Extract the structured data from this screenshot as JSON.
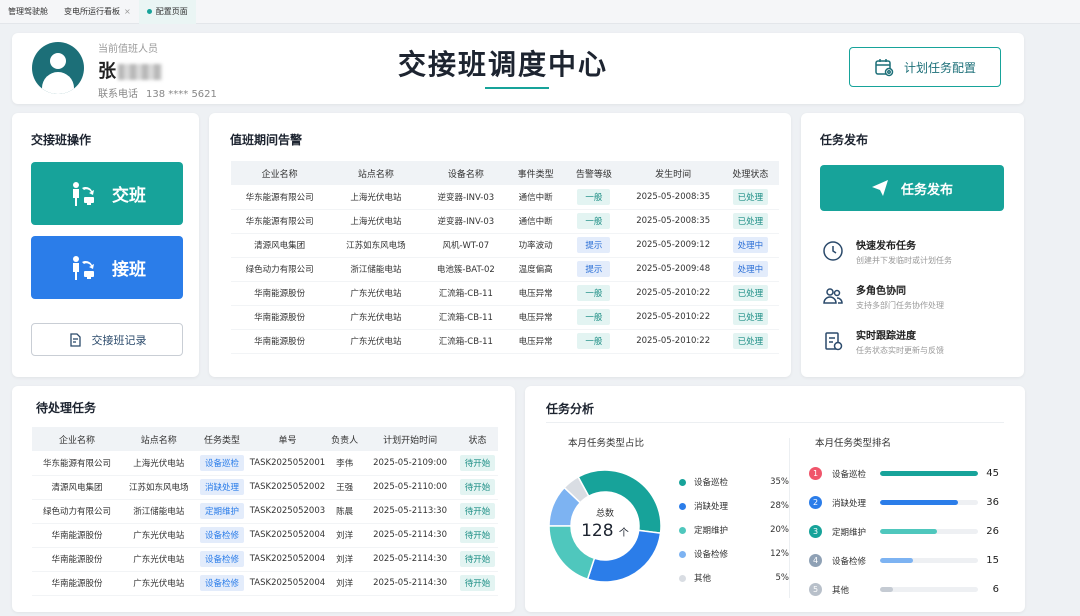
{
  "tabs": [
    {
      "label": "管理驾驶舱",
      "active": false,
      "closable": false
    },
    {
      "label": "变电所运行看板",
      "active": false,
      "closable": true
    },
    {
      "label": "配置页面",
      "active": true,
      "closable": false
    }
  ],
  "header": {
    "duty_label": "当前值班人员",
    "duty_name": "张",
    "phone_label": "联系电话",
    "phone_value": "138 **** 5621",
    "title": "交接班调度中心",
    "config_button": "计划任务配置"
  },
  "handover": {
    "title": "交接班操作",
    "handover_button": "交班",
    "takeover_button": "接班",
    "record_button": "交接班记录"
  },
  "alarms": {
    "title": "值班期间告警",
    "columns": [
      "企业名称",
      "站点名称",
      "设备名称",
      "事件类型",
      "告警等级",
      "发生时间",
      "处理状态"
    ],
    "rows": [
      {
        "company": "华东能源有限公司",
        "station": "上海光伏电站",
        "device": "逆变器-INV-03",
        "event": "通信中断",
        "level": "一般",
        "time": "2025-05-2008:35",
        "status": "已处理"
      },
      {
        "company": "华东能源有限公司",
        "station": "上海光伏电站",
        "device": "逆变器-INV-03",
        "event": "通信中断",
        "level": "一般",
        "time": "2025-05-2008:35",
        "status": "已处理"
      },
      {
        "company": "清源风电集团",
        "station": "江苏如东风电场",
        "device": "风机-WT-07",
        "event": "功率波动",
        "level": "提示",
        "time": "2025-05-2009:12",
        "status": "处理中"
      },
      {
        "company": "绿色动力有限公司",
        "station": "浙江储能电站",
        "device": "电池簇-BAT-02",
        "event": "温度偏高",
        "level": "提示",
        "time": "2025-05-2009:48",
        "status": "处理中"
      },
      {
        "company": "华南能源股份",
        "station": "广东光伏电站",
        "device": "汇流箱-CB-11",
        "event": "电压异常",
        "level": "一般",
        "time": "2025-05-2010:22",
        "status": "已处理"
      },
      {
        "company": "华南能源股份",
        "station": "广东光伏电站",
        "device": "汇流箱-CB-11",
        "event": "电压异常",
        "level": "一般",
        "time": "2025-05-2010:22",
        "status": "已处理"
      },
      {
        "company": "华南能源股份",
        "station": "广东光伏电站",
        "device": "汇流箱-CB-11",
        "event": "电压异常",
        "level": "一般",
        "time": "2025-05-2010:22",
        "status": "已处理"
      }
    ]
  },
  "publish": {
    "title": "任务发布",
    "button": "任务发布",
    "features": [
      {
        "icon": "clock-icon",
        "title": "快速发布任务",
        "desc": "创建并下发临时或计划任务"
      },
      {
        "icon": "users-icon",
        "title": "多角色协同",
        "desc": "支持多部门任务协作处理"
      },
      {
        "icon": "clipboard-icon",
        "title": "实时跟踪进度",
        "desc": "任务状态实时更新与反馈"
      }
    ]
  },
  "pending": {
    "title": "待处理任务",
    "columns": [
      "企业名称",
      "站点名称",
      "任务类型",
      "单号",
      "负责人",
      "计划开始时间",
      "状态"
    ],
    "rows": [
      {
        "company": "华东能源有限公司",
        "station": "上海光伏电站",
        "type": "设备巡检",
        "id": "TASK2025052001",
        "owner": "李伟",
        "time": "2025-05-2109:00",
        "status": "待开始"
      },
      {
        "company": "清源风电集团",
        "station": "江苏如东风电场",
        "type": "消缺处理",
        "id": "TASK2025052002",
        "owner": "王强",
        "time": "2025-05-2110:00",
        "status": "待开始"
      },
      {
        "company": "绿色动力有限公司",
        "station": "浙江储能电站",
        "type": "定期维护",
        "id": "TASK2025052003",
        "owner": "陈晨",
        "time": "2025-05-2113:30",
        "status": "待开始"
      },
      {
        "company": "华南能源股份",
        "station": "广东光伏电站",
        "type": "设备检修",
        "id": "TASK2025052004",
        "owner": "刘洋",
        "time": "2025-05-2114:30",
        "status": "待开始"
      },
      {
        "company": "华南能源股份",
        "station": "广东光伏电站",
        "type": "设备检修",
        "id": "TASK2025052004",
        "owner": "刘洋",
        "time": "2025-05-2114:30",
        "status": "待开始"
      },
      {
        "company": "华南能源股份",
        "station": "广东光伏电站",
        "type": "设备检修",
        "id": "TASK2025052004",
        "owner": "刘洋",
        "time": "2025-05-2114:30",
        "status": "待开始"
      }
    ]
  },
  "analysis": {
    "title": "任务分析",
    "pie_title": "本月任务类型占比",
    "rank_title": "本月任务类型排名",
    "total_label": "总数",
    "total_value": "128",
    "total_unit": "个"
  },
  "chart_data": [
    {
      "type": "pie",
      "title": "本月任务类型占比",
      "categories": [
        "设备巡检",
        "消缺处理",
        "定期维护",
        "设备检修",
        "其他"
      ],
      "values": [
        35,
        28,
        20,
        12,
        5
      ],
      "value_labels": [
        "35%",
        "28%",
        "20%",
        "12%",
        "5%"
      ],
      "colors": [
        "#17a39a",
        "#2b7de9",
        "#4fc7bd",
        "#7db3f2",
        "#d9dde3"
      ],
      "center_label": "总数",
      "center_value": "128",
      "center_unit": "个",
      "style": "donut",
      "legend": "right"
    },
    {
      "type": "bar",
      "title": "本月任务类型排名",
      "orientation": "horizontal",
      "categories": [
        "设备巡检",
        "消缺处理",
        "定期维护",
        "设备检修",
        "其他"
      ],
      "ranks": [
        "1",
        "2",
        "3",
        "4",
        "5"
      ],
      "values": [
        45,
        36,
        26,
        15,
        6
      ],
      "colors": [
        "#17a39a",
        "#2b7de9",
        "#4fc7bd",
        "#7db3f2",
        "#c5cbd3"
      ],
      "rank_colors": [
        "#f0556b",
        "#2b7de9",
        "#17a39a",
        "#8fa1b5",
        "#b8c0ca"
      ],
      "xlim": [
        0,
        45
      ]
    }
  ]
}
